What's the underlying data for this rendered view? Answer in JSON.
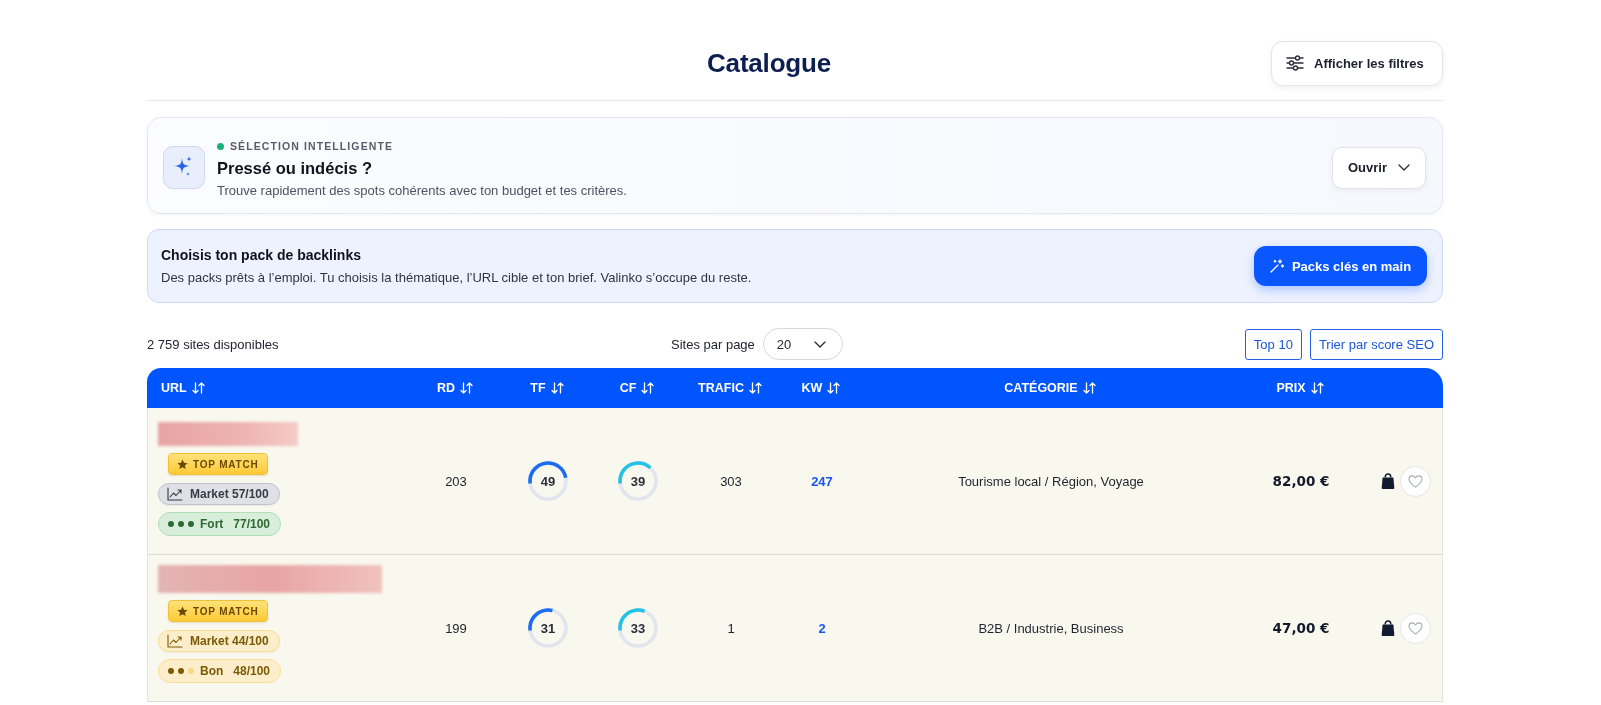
{
  "header": {
    "title": "Catalogue",
    "filters_button": "Afficher les filtres"
  },
  "smart_selection": {
    "eyebrow": "SÉLECTION INTELLIGENTE",
    "title": "Pressé ou indécis ?",
    "description": "Trouve rapidement des spots cohérents avec ton budget et tes critères.",
    "button": "Ouvrir",
    "expanded": false
  },
  "packs_banner": {
    "title": "Choisis ton pack de backlinks",
    "description": "Des packs prêts à l’emploi. Tu choisis la thématique, l’URL cible et ton brief. Valinko s’occupe du reste.",
    "button": "Packs clés en main"
  },
  "toolbar": {
    "count": "2 759 sites disponibles",
    "per_page": {
      "label": "Sites par page",
      "value": "20"
    },
    "buttons": [
      "Top 10",
      "Trier par score SEO"
    ]
  },
  "table": {
    "columns": [
      {
        "label": "URL",
        "sortable": true
      },
      {
        "label": "RD",
        "sortable": true
      },
      {
        "label": "TF",
        "sortable": true
      },
      {
        "label": "CF",
        "sortable": true
      },
      {
        "label": "TRAFIC",
        "sortable": true
      },
      {
        "label": "KW",
        "sortable": true
      },
      {
        "label": "CATÉGORIE",
        "sortable": true
      },
      {
        "label": "PRIX",
        "sortable": true
      }
    ],
    "rows": [
      {
        "top_match": "TOP MATCH",
        "market": {
          "label": "Market 57/100",
          "color": "#363b48"
        },
        "quality": {
          "label": "Fort",
          "score": "77/100",
          "stars": 3,
          "color": "#2d6a33"
        },
        "rd": "203",
        "tf": {
          "value": "49",
          "level": 0.49
        },
        "cf": {
          "value": "39",
          "level": 0.39
        },
        "traffic": "303",
        "kw": "247",
        "category": "Tourisme local / Région, Voyage",
        "price": "82,00 €"
      },
      {
        "top_match": "TOP MATCH",
        "market": {
          "label": "Market 44/100",
          "color": "#7a5a06"
        },
        "quality": {
          "label": "Bon",
          "score": "48/100",
          "stars": 2,
          "color": "#7a5a06"
        },
        "rd": "199",
        "tf": {
          "value": "31",
          "level": 0.31
        },
        "cf": {
          "value": "33",
          "level": 0.33
        },
        "traffic": "1",
        "kw": "2",
        "category": "B2B / Industrie, Business",
        "price": "47,00 €"
      }
    ]
  }
}
